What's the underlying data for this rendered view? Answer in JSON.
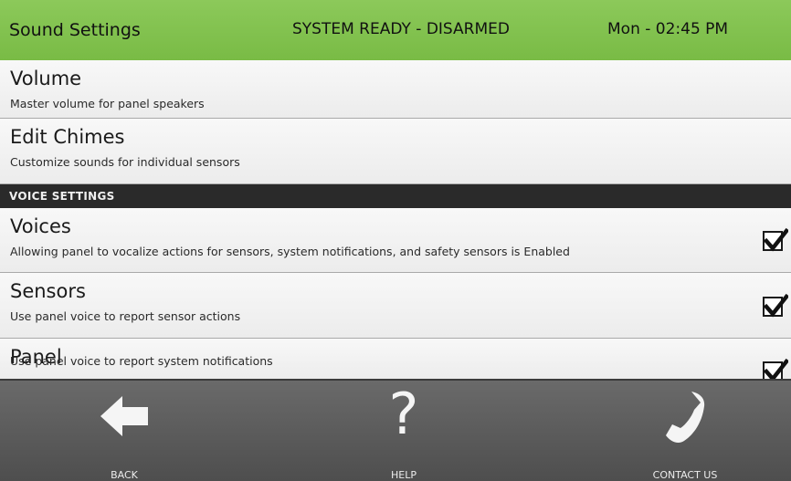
{
  "header": {
    "title": "Sound Settings",
    "status": "SYSTEM READY - DISARMED",
    "time": "Mon - 02:45 PM",
    "bg_color": "#7fbf4d"
  },
  "rows": [
    {
      "title": "Volume",
      "subtitle": "Master volume for panel speakers"
    },
    {
      "title": "Edit Chimes",
      "subtitle": "Customize sounds for individual sensors"
    }
  ],
  "section": {
    "title": "VOICE SETTINGS"
  },
  "voice_rows": [
    {
      "title": "Voices",
      "subtitle": "Allowing panel to vocalize actions for sensors, system notifications, and safety sensors is Enabled",
      "checked": true
    },
    {
      "title": "Sensors",
      "subtitle": "Use panel voice to report sensor actions",
      "checked": true
    },
    {
      "title": "Panel",
      "subtitle": "Use panel voice to report system notifications",
      "checked": true
    }
  ],
  "footer": {
    "back": {
      "label": "BACK",
      "icon": "arrow-left-icon"
    },
    "help": {
      "label": "HELP",
      "icon": "question-mark-icon"
    },
    "contact": {
      "label": "CONTACT US",
      "icon": "phone-icon"
    }
  }
}
